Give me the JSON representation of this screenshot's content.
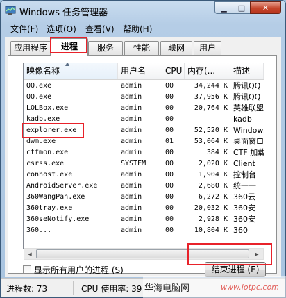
{
  "window": {
    "title": "Windows 任务管理器"
  },
  "title_buttons": {
    "minimize": "▁",
    "maximize": "□",
    "close": "✕"
  },
  "menu": {
    "items": [
      "文件(F)",
      "选项(O)",
      "查看(V)",
      "帮助(H)"
    ]
  },
  "tabs": [
    "应用程序",
    "进程",
    "服务",
    "性能",
    "联网",
    "用户"
  ],
  "active_tab": "进程",
  "table": {
    "columns": [
      "映像名称",
      "用户名",
      "CPU",
      "内存(...",
      "描述"
    ],
    "sorted_column": "映像名称",
    "rows": [
      [
        "QQ.exe",
        "admin",
        "00",
        "34,244 K",
        "腾讯QQ"
      ],
      [
        "QQ.exe",
        "admin",
        "00",
        "37,956 K",
        "腾讯QQ"
      ],
      [
        "LOLBox.exe",
        "admin",
        "00",
        "20,764 K",
        "英雄联盟"
      ],
      [
        "kadb.exe",
        "admin",
        "00",
        "",
        "kadb"
      ],
      [
        "explorer.exe",
        "admin",
        "00",
        "52,520 K",
        "Windows"
      ],
      [
        "dwm.exe",
        "admin",
        "01",
        "53,064 K",
        "桌面窗口"
      ],
      [
        "ctfmon.exe",
        "admin",
        "00",
        "384 K",
        "CTF 加载"
      ],
      [
        "csrss.exe",
        "SYSTEM",
        "00",
        "2,020 K",
        "Client"
      ],
      [
        "conhost.exe",
        "admin",
        "00",
        "1,904 K",
        "控制台"
      ],
      [
        "AndroidServer.exe",
        "admin",
        "00",
        "2,680 K",
        "统一一"
      ],
      [
        "360WangPan.exe",
        "admin",
        "00",
        "6,272 K",
        "360云"
      ],
      [
        "360tray.exe",
        "admin",
        "00",
        "20,032 K",
        "360安"
      ],
      [
        "360seNotify.exe",
        "admin",
        "00",
        "2,928 K",
        "360安"
      ],
      [
        "360...",
        "admin",
        "00",
        "10,804 K",
        "360"
      ]
    ]
  },
  "highlighted_process": "explorer.exe",
  "show_all_users_label": "显示所有用户的进程 (S)",
  "end_process_label": "结束进程 (E)",
  "status": {
    "processes": "进程数: 73",
    "cpu": "CPU 使用率: 39"
  },
  "watermark": {
    "text": "华海电脑网",
    "url": "www.lotpc.com"
  }
}
